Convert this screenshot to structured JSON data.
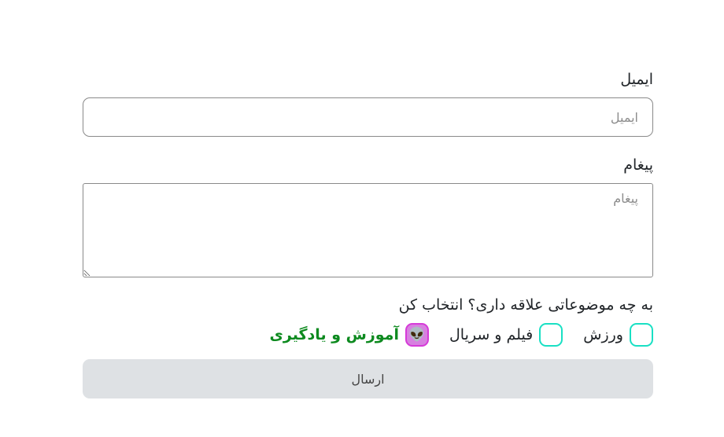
{
  "form": {
    "email": {
      "label": "ایمیل",
      "placeholder": "ایمیل",
      "value": ""
    },
    "message": {
      "label": "پیغام",
      "placeholder": "پیغام",
      "value": ""
    },
    "topics": {
      "question": "به چه موضوعاتی علاقه داری؟ انتخاب کن",
      "options": [
        {
          "label": "ورزش",
          "checked": false
        },
        {
          "label": "فیلم و سریال",
          "checked": false
        },
        {
          "label": "آموزش و یادگیری",
          "checked": true,
          "icon": "alien-emoji-icon",
          "glyph": "👽",
          "label_color": "#0d8a1f"
        }
      ]
    },
    "submit_label": "ارسال"
  },
  "colors": {
    "checkbox_border": "#19e0c4",
    "checkbox_checked_bg": "#d780e0",
    "selected_text": "#0d8a1f",
    "submit_bg": "#dee1e4"
  }
}
